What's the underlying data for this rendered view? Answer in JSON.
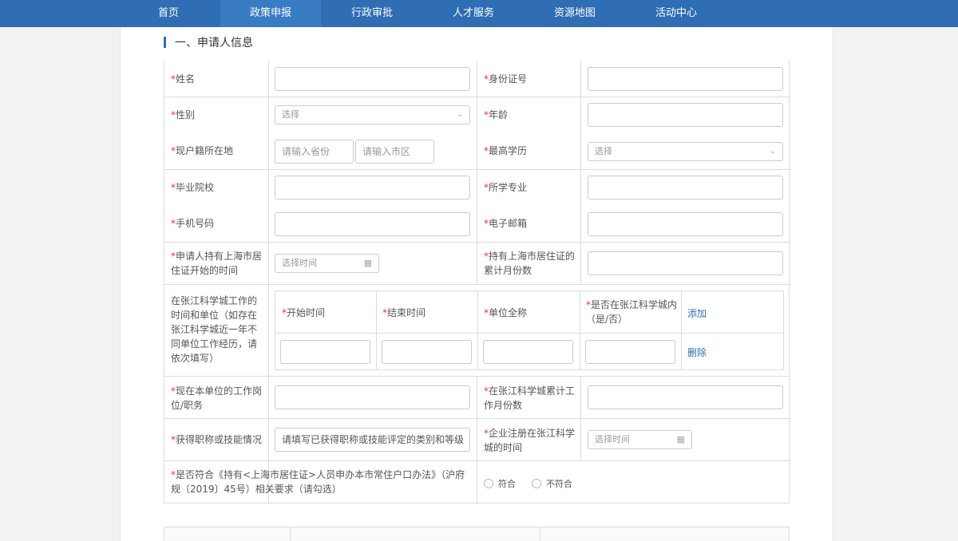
{
  "nav": {
    "items": [
      {
        "label": "首页"
      },
      {
        "label": "政策申报"
      },
      {
        "label": "行政审批"
      },
      {
        "label": "人才服务"
      },
      {
        "label": "资源地图"
      },
      {
        "label": "活动中心"
      }
    ],
    "active": 1
  },
  "section": {
    "title": "一、申请人信息"
  },
  "form": {
    "required_mark": "*",
    "name": {
      "label": "姓名"
    },
    "id_number": {
      "label": "身份证号"
    },
    "gender": {
      "label": "性别",
      "placeholder": "选择"
    },
    "age": {
      "label": "年龄"
    },
    "hukou": {
      "label": "现户籍所在地",
      "province_placeholder": "请输入省份",
      "city_placeholder": "请输入市区"
    },
    "education": {
      "label": "最高学历",
      "placeholder": "选择"
    },
    "school": {
      "label": "毕业院校"
    },
    "major": {
      "label": "所学专业"
    },
    "phone": {
      "label": "手机号码"
    },
    "email": {
      "label": "电子邮箱"
    },
    "permit_start": {
      "label": "申请人持有上海市居住证开始的时间",
      "placeholder": "选择时间"
    },
    "permit_months": {
      "label": "持有上海市居住证的累计月份数"
    },
    "work_history": {
      "label": "在张江科学城工作的时间和单位（如存在张江科学城近一年不同单位工作经历，请依次填写）",
      "col_start": "开始时间",
      "col_end": "结束时间",
      "col_company": "单位全称",
      "col_in_zhangjiang": "是否在张江科学城内（是/否）",
      "add": "添加",
      "delete": "删除"
    },
    "position": {
      "label": "现在本单位的工作岗位/职务"
    },
    "zj_months": {
      "label": "在张江科学城累计工作月份数"
    },
    "title_skill": {
      "label": "获得职称或技能情况",
      "value": "请填写已获得职称或技能评定的类别和等级"
    },
    "company_reg": {
      "label": "企业注册在张江科学城的时间",
      "placeholder": "选择时间"
    },
    "compliance": {
      "label": "是否符合《持有<上海市居住证>人员申办本市常住户口办法》（沪府规〔2019〕45号）相关要求（请勾选）",
      "yes": "符合",
      "no": "不符合"
    }
  }
}
